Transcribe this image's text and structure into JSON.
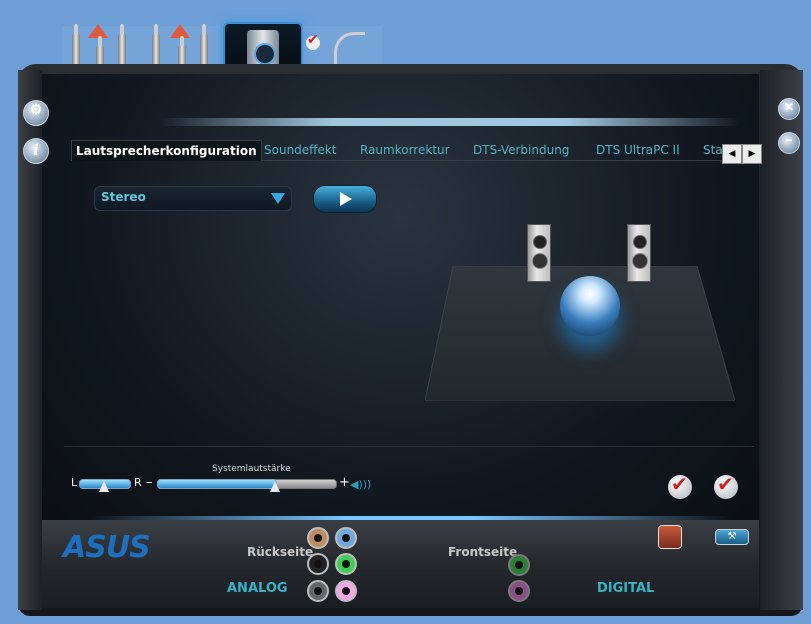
{
  "tabs": [
    "Lautsprecherkonfiguration",
    "Soundeffekt",
    "Raumkorrektur",
    "DTS-Verbindung",
    "DTS UltraPC II",
    "Sta"
  ],
  "active_tab": "Lautsprecherkonfiguration",
  "speaker_config": {
    "selected": "Stereo"
  },
  "volume": {
    "title": "Systemlautstärke",
    "left_label": "L",
    "right_label": "R",
    "minus": "–",
    "plus": "+",
    "level": 0.73,
    "balance": 0.5
  },
  "bottom": {
    "brand": "ASUS",
    "rear_label": "Rückseite",
    "front_label": "Frontseite",
    "analog_label": "ANALOG",
    "digital_label": "DIGITAL"
  },
  "colors": {
    "accent": "#4fb3c4",
    "brand": "#1d6fc0",
    "background": "#6d9fd6"
  },
  "icons": [
    "settings-gear-icon",
    "info-icon",
    "close-icon",
    "minimize-icon",
    "play-icon",
    "checkmark-icon",
    "wrench-icon",
    "speaker-icon",
    "microphone-icon",
    "sphere-icon"
  ]
}
